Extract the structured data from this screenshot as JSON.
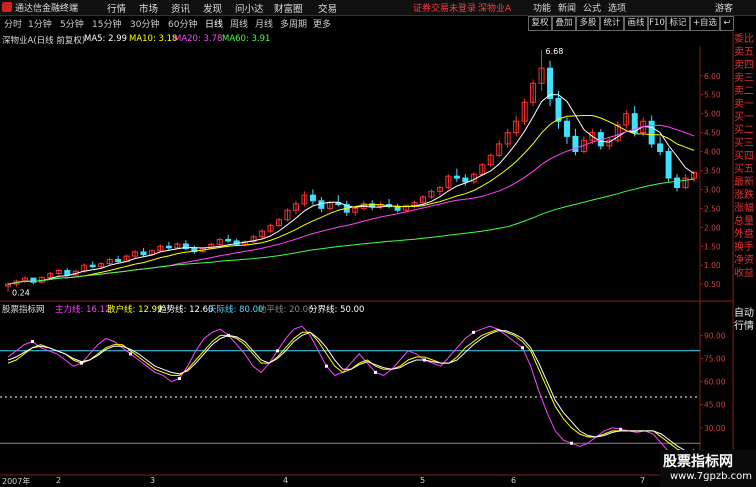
{
  "titlebar": {
    "app_title": "通达信金融终端",
    "menus": [
      "行情",
      "市场",
      "资讯",
      "发现",
      "问小达",
      "财富圈",
      "交易"
    ],
    "status_text": "证券交易未登录",
    "stock_name": "深物业A",
    "right_menus": [
      "功能",
      "新闻",
      "公式",
      "选项"
    ],
    "user": "游客"
  },
  "toolbar": {
    "periods": [
      "分时",
      "1分钟",
      "5分钟",
      "15分钟",
      "30分钟",
      "60分钟",
      "日线",
      "周线",
      "月线",
      "多周期",
      "更多"
    ],
    "selected_period": "日线",
    "right_buttons": [
      "复权",
      "叠加",
      "多股",
      "统计",
      "画线",
      "F10",
      "标记",
      "+自选",
      "↩"
    ]
  },
  "price_panel": {
    "title": "深物业A(日线 前复权)",
    "ma": [
      {
        "label": "MA5: 2.99",
        "color": "#ffffff"
      },
      {
        "label": "MA10: 3.18",
        "color": "#ffff00"
      },
      {
        "label": "MA20: 3.78",
        "color": "#ff44ff"
      },
      {
        "label": "MA60: 3.91",
        "color": "#44ff44"
      }
    ],
    "y_ticks": [
      "6.00",
      "5.50",
      "5.00",
      "4.50",
      "4.00",
      "3.50",
      "3.00",
      "2.50",
      "2.00",
      "1.50",
      "1.00",
      "0.50"
    ],
    "max_label": "6.68",
    "min_label": "0.24"
  },
  "sidebar": {
    "items": [
      "委比",
      "卖五",
      "卖四",
      "卖三",
      "卖二",
      "卖一",
      "买一",
      "买二",
      "买三",
      "买四",
      "买五",
      "最新",
      "涨跌",
      "涨幅",
      "总量",
      "外盘",
      "换手",
      "净资",
      "收益"
    ],
    "bottom_items": [
      "自动",
      "行情"
    ]
  },
  "indicator_panel": {
    "title": "股票指标网",
    "items": [
      {
        "label": "主力线: 16.12",
        "color": "#ff44ff"
      },
      {
        "label": "散户线: 12.99",
        "color": "#ffff00"
      },
      {
        "label": "趋势线: 12.60",
        "color": "#ffffff"
      },
      {
        "label": "天际线: 80.00",
        "color": "#4fd5ff"
      },
      {
        "label": "地平线: 20.00",
        "color": "#888888"
      },
      {
        "label": "分界线: 50.00",
        "color": "#ffffff"
      }
    ],
    "y_ticks": [
      "90.00",
      "75.00",
      "60.00",
      "45.00",
      "30.00"
    ]
  },
  "date_axis": [
    "2007年",
    "2",
    "3",
    "4",
    "5",
    "6",
    "7"
  ],
  "watermark": {
    "line1": "股票指标网",
    "line2": "www.7gpzb.com"
  },
  "chart_data": {
    "type": "candlestick",
    "x": [
      0,
      2,
      4,
      6,
      8,
      10,
      12,
      14,
      16,
      18,
      20,
      22,
      24,
      26,
      28,
      30,
      32,
      34,
      36,
      38,
      40,
      42,
      44,
      46,
      48,
      50,
      52,
      54,
      56,
      58,
      60,
      62,
      64,
      66,
      68,
      70,
      72,
      74,
      76,
      78,
      80,
      82,
      84,
      86,
      88,
      90,
      92,
      94,
      96,
      98,
      100,
      102,
      104,
      106,
      108,
      110,
      112,
      114,
      116,
      118,
      120,
      122,
      124,
      126,
      128,
      130,
      132,
      134,
      136,
      138,
      140,
      142,
      144,
      146,
      148,
      150,
      152,
      154,
      156,
      158,
      160,
      162,
      164,
      166,
      168,
      170,
      172,
      174,
      176,
      178,
      180,
      182,
      184,
      186,
      188,
      190,
      192,
      194,
      196,
      198,
      200,
      202,
      204,
      206,
      208,
      210,
      212,
      214,
      216,
      218,
      220,
      222,
      224,
      226,
      228,
      230,
      232,
      234,
      236,
      238,
      240,
      242,
      244,
      246,
      248,
      250,
      252,
      254,
      256,
      258,
      260,
      262,
      264,
      266,
      268,
      270,
      272,
      274,
      276,
      278,
      280,
      282,
      284,
      286,
      288,
      290,
      292,
      294,
      296,
      298,
      300,
      302,
      304,
      306,
      308,
      310,
      312,
      314,
      316,
      318,
      320,
      322,
      324,
      326,
      328,
      330,
      332,
      334,
      336,
      338,
      340,
      342,
      344,
      346,
      348,
      350,
      352,
      354,
      356,
      358,
      360,
      362,
      364,
      366,
      368,
      370,
      372,
      374,
      376,
      378,
      380,
      382,
      384,
      386,
      388,
      390,
      392,
      394,
      396,
      398,
      400,
      402,
      404,
      406,
      408,
      410,
      412,
      414,
      416,
      418,
      420,
      422,
      424,
      426,
      428,
      430,
      432,
      434,
      436,
      438,
      440,
      442,
      444,
      446,
      448,
      450,
      452,
      454,
      456,
      458,
      460,
      462,
      464,
      466,
      468,
      470,
      472,
      474,
      476,
      478,
      480,
      482,
      484,
      486,
      488,
      490,
      492,
      494,
      496,
      498,
      500,
      502,
      504,
      506,
      508,
      510,
      512,
      514,
      516,
      518,
      520,
      522,
      524,
      526,
      528,
      530,
      532,
      534,
      536,
      538,
      540,
      542,
      544,
      546,
      548,
      550,
      552,
      554,
      556,
      558,
      560,
      562,
      564,
      566,
      568,
      570,
      572,
      574,
      576,
      578,
      580,
      582,
      584,
      586,
      588,
      590,
      592,
      594,
      596,
      598,
      600,
      602,
      604,
      606,
      608,
      610,
      612,
      614,
      616,
      618,
      620,
      622,
      624,
      626,
      628,
      630,
      632,
      634,
      636,
      638,
      640,
      642,
      644,
      646,
      648,
      650,
      652,
      654,
      656,
      658,
      660,
      662,
      664,
      666,
      668,
      670,
      672,
      674,
      676,
      678,
      680,
      682,
      684,
      686,
      688,
      690,
      692,
      694,
      696,
      698
    ],
    "close": [],
    "note_ranges": {
      "price_ylim": [
        0.24,
        6.68
      ],
      "indicator_ylim": [
        0,
        100
      ]
    },
    "series": [
      {
        "name": "主力线",
        "panel": "indicator",
        "color": "#ff44ff"
      },
      {
        "name": "散户线",
        "panel": "indicator",
        "color": "#ffff00"
      },
      {
        "name": "趋势线",
        "panel": "indicator",
        "color": "#ffffff"
      }
    ],
    "indicator_levels": {
      "天际线": 80,
      "地平线": 20,
      "分界线": 50
    },
    "candles": [
      [
        0.45,
        0.55,
        0.3,
        0.5
      ],
      [
        0.5,
        0.62,
        0.44,
        0.58
      ],
      [
        0.58,
        0.7,
        0.52,
        0.66
      ],
      [
        0.66,
        0.66,
        0.5,
        0.55
      ],
      [
        0.55,
        0.7,
        0.52,
        0.68
      ],
      [
        0.68,
        0.82,
        0.64,
        0.78
      ],
      [
        0.78,
        0.9,
        0.72,
        0.86
      ],
      [
        0.86,
        0.92,
        0.7,
        0.74
      ],
      [
        0.74,
        0.88,
        0.7,
        0.84
      ],
      [
        0.84,
        1.05,
        0.8,
        1.0
      ],
      [
        1.0,
        1.1,
        0.92,
        0.96
      ],
      [
        0.96,
        1.08,
        0.9,
        1.04
      ],
      [
        1.04,
        1.2,
        1.0,
        1.15
      ],
      [
        1.15,
        1.25,
        1.05,
        1.1
      ],
      [
        1.1,
        1.28,
        1.08,
        1.24
      ],
      [
        1.24,
        1.4,
        1.2,
        1.35
      ],
      [
        1.35,
        1.45,
        1.22,
        1.28
      ],
      [
        1.28,
        1.42,
        1.24,
        1.38
      ],
      [
        1.38,
        1.55,
        1.34,
        1.5
      ],
      [
        1.5,
        1.62,
        1.4,
        1.46
      ],
      [
        1.46,
        1.6,
        1.42,
        1.56
      ],
      [
        1.56,
        1.66,
        1.4,
        1.44
      ],
      [
        1.44,
        1.52,
        1.3,
        1.36
      ],
      [
        1.36,
        1.48,
        1.32,
        1.45
      ],
      [
        1.45,
        1.6,
        1.42,
        1.55
      ],
      [
        1.55,
        1.72,
        1.5,
        1.68
      ],
      [
        1.68,
        1.8,
        1.6,
        1.64
      ],
      [
        1.64,
        1.7,
        1.5,
        1.55
      ],
      [
        1.55,
        1.66,
        1.5,
        1.62
      ],
      [
        1.62,
        1.8,
        1.58,
        1.75
      ],
      [
        1.75,
        1.95,
        1.7,
        1.9
      ],
      [
        1.9,
        2.1,
        1.85,
        2.05
      ],
      [
        2.05,
        2.25,
        2.0,
        2.2
      ],
      [
        2.2,
        2.5,
        2.15,
        2.45
      ],
      [
        2.45,
        2.7,
        2.35,
        2.62
      ],
      [
        2.62,
        2.95,
        2.55,
        2.85
      ],
      [
        2.85,
        3.0,
        2.6,
        2.7
      ],
      [
        2.7,
        2.8,
        2.4,
        2.5
      ],
      [
        2.5,
        2.7,
        2.45,
        2.65
      ],
      [
        2.65,
        2.85,
        2.55,
        2.6
      ],
      [
        2.6,
        2.7,
        2.3,
        2.4
      ],
      [
        2.4,
        2.55,
        2.3,
        2.5
      ],
      [
        2.5,
        2.7,
        2.45,
        2.62
      ],
      [
        2.62,
        2.72,
        2.45,
        2.55
      ],
      [
        2.55,
        2.68,
        2.48,
        2.6
      ],
      [
        2.6,
        2.75,
        2.5,
        2.55
      ],
      [
        2.55,
        2.62,
        2.4,
        2.45
      ],
      [
        2.45,
        2.6,
        2.4,
        2.58
      ],
      [
        2.58,
        2.7,
        2.5,
        2.65
      ],
      [
        2.65,
        2.85,
        2.6,
        2.8
      ],
      [
        2.8,
        3.0,
        2.75,
        2.95
      ],
      [
        2.95,
        3.1,
        2.85,
        3.05
      ],
      [
        3.05,
        3.4,
        3.0,
        3.35
      ],
      [
        3.35,
        3.55,
        3.2,
        3.3
      ],
      [
        3.3,
        3.4,
        3.1,
        3.2
      ],
      [
        3.2,
        3.45,
        3.15,
        3.4
      ],
      [
        3.4,
        3.7,
        3.35,
        3.65
      ],
      [
        3.65,
        3.95,
        3.6,
        3.9
      ],
      [
        3.9,
        4.3,
        3.85,
        4.2
      ],
      [
        4.2,
        4.6,
        4.1,
        4.5
      ],
      [
        4.5,
        4.95,
        4.4,
        4.8
      ],
      [
        4.8,
        5.4,
        4.7,
        5.3
      ],
      [
        5.3,
        5.9,
        5.2,
        5.8
      ],
      [
        5.8,
        6.68,
        5.6,
        6.2
      ],
      [
        6.2,
        6.4,
        5.2,
        5.4
      ],
      [
        5.4,
        5.6,
        4.6,
        4.8
      ],
      [
        4.8,
        4.9,
        4.2,
        4.4
      ],
      [
        4.4,
        4.6,
        3.9,
        4.0
      ],
      [
        4.0,
        4.4,
        3.95,
        4.3
      ],
      [
        4.3,
        4.6,
        4.2,
        4.5
      ],
      [
        4.5,
        4.6,
        4.05,
        4.15
      ],
      [
        4.15,
        4.4,
        4.05,
        4.3
      ],
      [
        4.3,
        4.8,
        4.25,
        4.7
      ],
      [
        4.7,
        5.1,
        4.6,
        5.0
      ],
      [
        5.0,
        5.2,
        4.4,
        4.5
      ],
      [
        4.5,
        4.9,
        4.4,
        4.8
      ],
      [
        4.8,
        4.95,
        4.1,
        4.2
      ],
      [
        4.2,
        4.4,
        3.9,
        4.0
      ],
      [
        4.0,
        4.1,
        3.2,
        3.3
      ],
      [
        3.3,
        3.4,
        2.95,
        3.05
      ],
      [
        3.05,
        3.4,
        3.0,
        3.3
      ],
      [
        3.3,
        3.5,
        3.2,
        3.45
      ]
    ],
    "indicator": {
      "main": [
        76,
        80,
        84,
        86,
        82,
        80,
        78,
        74,
        70,
        72,
        78,
        84,
        88,
        86,
        82,
        78,
        74,
        70,
        66,
        64,
        60,
        62,
        70,
        80,
        88,
        92,
        94,
        90,
        84,
        78,
        70,
        66,
        72,
        80,
        88,
        94,
        96,
        90,
        80,
        70,
        64,
        66,
        72,
        78,
        72,
        66,
        64,
        68,
        74,
        80,
        78,
        74,
        72,
        70,
        76,
        82,
        88,
        92,
        94,
        96,
        94,
        90,
        86,
        82,
        70,
        54,
        40,
        28,
        22,
        20,
        18,
        20,
        24,
        28,
        30,
        29,
        28,
        27,
        28,
        26,
        20,
        14,
        12,
        13,
        16
      ],
      "retail": [
        72,
        74,
        78,
        82,
        84,
        82,
        80,
        78,
        74,
        72,
        74,
        78,
        82,
        84,
        84,
        80,
        76,
        72,
        68,
        66,
        64,
        64,
        68,
        74,
        80,
        86,
        90,
        90,
        88,
        84,
        78,
        72,
        72,
        76,
        82,
        88,
        92,
        92,
        86,
        78,
        70,
        66,
        68,
        72,
        74,
        70,
        68,
        68,
        70,
        74,
        76,
        76,
        74,
        72,
        72,
        76,
        82,
        86,
        90,
        92,
        94,
        92,
        90,
        86,
        80,
        68,
        56,
        44,
        36,
        30,
        26,
        24,
        24,
        26,
        28,
        28,
        28,
        28,
        28,
        28,
        24,
        20,
        16,
        14,
        13
      ],
      "trend": [
        74,
        76,
        79,
        82,
        83,
        82,
        80,
        78,
        75,
        73,
        74,
        77,
        81,
        83,
        83,
        81,
        78,
        74,
        70,
        68,
        66,
        65,
        67,
        72,
        78,
        84,
        88,
        90,
        89,
        86,
        80,
        74,
        72,
        75,
        80,
        86,
        90,
        92,
        88,
        82,
        74,
        68,
        68,
        71,
        73,
        71,
        69,
        68,
        69,
        72,
        74,
        74,
        73,
        72,
        72,
        74,
        79,
        84,
        88,
        91,
        93,
        93,
        91,
        88,
        82,
        72,
        60,
        48,
        40,
        34,
        28,
        25,
        24,
        25,
        27,
        28,
        28,
        28,
        28,
        28,
        26,
        22,
        18,
        15,
        13
      ]
    }
  }
}
